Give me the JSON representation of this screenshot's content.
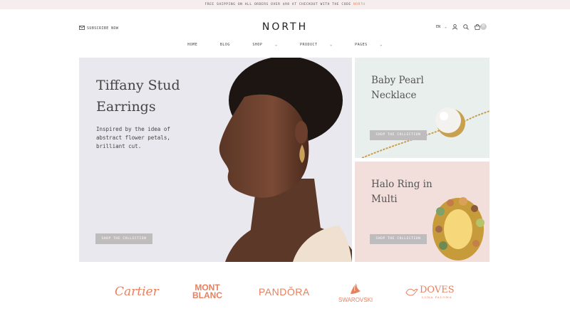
{
  "topbar": {
    "text": "FREE SHIPPING ON ALL ORDERS OVER $98 AT CHECKOUT WITH THE CODE",
    "code": "NORTH"
  },
  "header": {
    "subscribe_label": "SUBSCRIBE NOW",
    "logo": "NORTH",
    "lang": "EN",
    "cart_count": "0"
  },
  "nav": {
    "items": [
      "HOME",
      "BLOG",
      "SHOP",
      "PRODUCT",
      "PAGES"
    ],
    "chevron": "⌄"
  },
  "hero": {
    "title": "Tiffany Stud Earrings",
    "description": "Inspired by the idea of abstract flower petals, brilliant cut.",
    "button": "SHOP THE COLLECTION"
  },
  "cards": [
    {
      "title": "Baby Pearl Necklace",
      "button": "SHOP THE COLLECTION"
    },
    {
      "title": "Halo Ring in Multi",
      "button": "SHOP THE COLLECTION"
    }
  ],
  "brands": {
    "cartier": "Cartier",
    "montblanc_line1": "MONT",
    "montblanc_line2": "BLANC",
    "pandora": "PANDŎRA",
    "swarovski": "SWAROVSKI",
    "doves": "DOVES",
    "doves_sub": "LUNA PALOMA"
  },
  "colors": {
    "accent": "#e8805f",
    "topbar_bg": "#f6eeec",
    "hero_bg": "#e9e8ee",
    "card1_bg": "#e8efec",
    "card2_bg": "#f2dedb"
  }
}
